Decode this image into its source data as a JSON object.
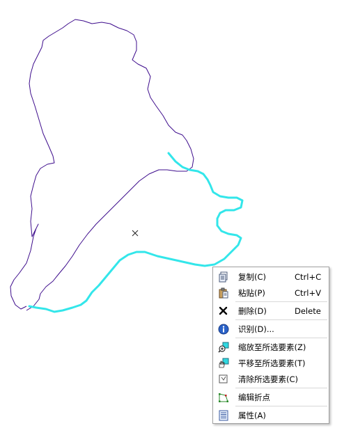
{
  "colors": {
    "polygon_outline": "#3d0c8c",
    "selected_line": "#33e6ea",
    "menu_border": "#a0a0a0",
    "separator": "#d8d8d8"
  },
  "map": {
    "cursor_icon": "x-marker-icon"
  },
  "context_menu": {
    "items": [
      {
        "id": "copy",
        "label": "复制(C)",
        "shortcut": "Ctrl+C",
        "icon": "copy-icon"
      },
      {
        "id": "paste",
        "label": "粘贴(P)",
        "shortcut": "Ctrl+V",
        "icon": "paste-icon"
      },
      {
        "id": "delete",
        "label": "删除(D)",
        "shortcut": "Delete",
        "icon": "delete-icon"
      },
      {
        "id": "identify",
        "label": "识别(D)...",
        "shortcut": "",
        "icon": "info-icon"
      },
      {
        "id": "zoom-to-selected",
        "label": "缩放至所选要素(Z)",
        "shortcut": "",
        "icon": "zoom-to-selected-icon"
      },
      {
        "id": "pan-to-selected",
        "label": "平移至所选要素(T)",
        "shortcut": "",
        "icon": "pan-to-selected-icon"
      },
      {
        "id": "clear-selected",
        "label": "清除所选要素(C)",
        "shortcut": "",
        "icon": "clear-selection-icon"
      },
      {
        "id": "edit-vertices",
        "label": "编辑折点",
        "shortcut": "",
        "icon": "edit-vertices-icon"
      },
      {
        "id": "properties",
        "label": "属性(A)",
        "shortcut": "",
        "icon": "properties-icon"
      }
    ]
  }
}
